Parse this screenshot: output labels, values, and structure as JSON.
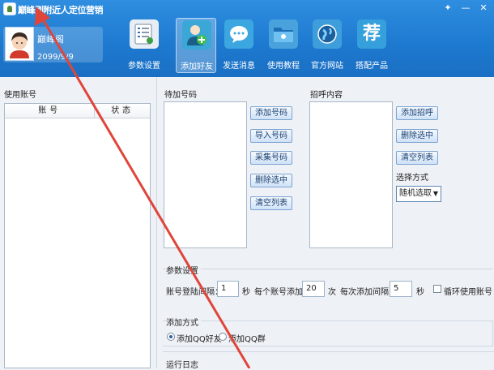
{
  "window": {
    "title": "巅峰刷附近人定位营销",
    "controls": [
      "✦",
      "—",
      "✕"
    ]
  },
  "user": {
    "name": "巅峰阁",
    "expiry": "2099/9/9"
  },
  "nav": [
    {
      "label": "参数设置",
      "icon": "settings-list-icon",
      "active": false
    },
    {
      "label": "添加好友",
      "icon": "add-friend-icon",
      "active": true
    },
    {
      "label": "发送消息",
      "icon": "chat-bubble-icon",
      "active": false
    },
    {
      "label": "使用教程",
      "icon": "folder-icon",
      "active": false
    },
    {
      "label": "官方网站",
      "icon": "globe-icon",
      "active": false
    },
    {
      "label": "搭配产品",
      "icon": "recommend-icon",
      "glyph": "荐",
      "active": false
    }
  ],
  "accounts": {
    "title": "使用账号",
    "columns": [
      "账号",
      "状态"
    ],
    "rows": []
  },
  "pending": {
    "title": "待加号码",
    "buttons": [
      "添加号码",
      "导入号码",
      "采集号码",
      "删除选中",
      "清空列表"
    ]
  },
  "greeting": {
    "title": "招呼内容",
    "buttons": [
      "添加招呼",
      "删除选中",
      "清空列表"
    ],
    "mode_label": "选择方式",
    "mode_value": "随机选取"
  },
  "params": {
    "title": "参数设置",
    "login_interval_label": "账号登陆间隔：",
    "login_interval": "1",
    "unit_sec": "秒",
    "per_account_label": "每个账号添加：",
    "per_account": "20",
    "unit_times": "次",
    "add_interval_label": "每次添加间隔：",
    "add_interval": "5",
    "loop_label": "循环使用账号"
  },
  "add_method": {
    "title": "添加方式",
    "options": [
      "添加QQ好友",
      "添加QQ群"
    ],
    "selected": 0
  },
  "log": {
    "title": "运行日志"
  },
  "colors": {
    "header": "#1d79cf",
    "annotation_arrow": "#e0453a"
  }
}
